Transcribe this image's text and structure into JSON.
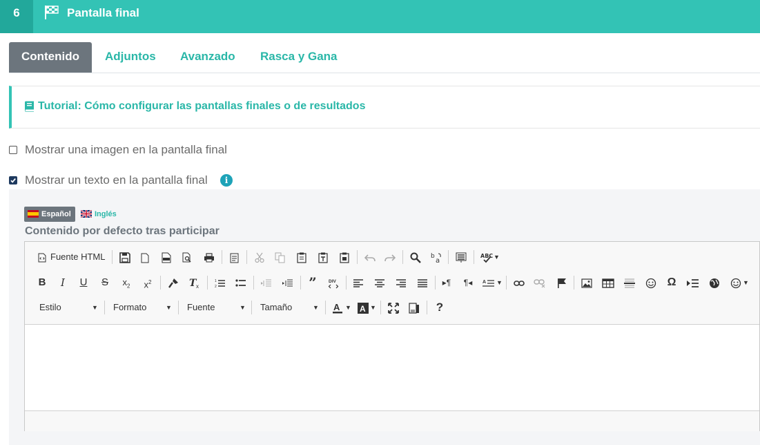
{
  "header": {
    "step": "6",
    "title": "Pantalla final"
  },
  "tabs": [
    {
      "label": "Contenido",
      "active": true
    },
    {
      "label": "Adjuntos",
      "active": false
    },
    {
      "label": "Avanzado",
      "active": false
    },
    {
      "label": "Rasca y Gana",
      "active": false
    }
  ],
  "tutorial": {
    "label": "Tutorial: Cómo configurar las pantallas finales o de resultados"
  },
  "options": {
    "image": {
      "label": "Mostrar una imagen en la pantalla final",
      "checked": false
    },
    "text": {
      "label": "Mostrar un texto en la pantalla final",
      "checked": true
    }
  },
  "languages": [
    {
      "label": "Español",
      "active": true
    },
    {
      "label": "Inglés",
      "active": false
    }
  ],
  "editor": {
    "label": "Contenido por defecto tras participar",
    "source_label": "Fuente HTML",
    "combos": {
      "style": "Estilo",
      "format": "Formato",
      "font": "Fuente",
      "size": "Tamaño"
    }
  },
  "colors": {
    "accent": "#33c3b5",
    "accent_dark": "#22a89b",
    "link": "#2ab7a8",
    "tab_active": "#6c757d"
  }
}
